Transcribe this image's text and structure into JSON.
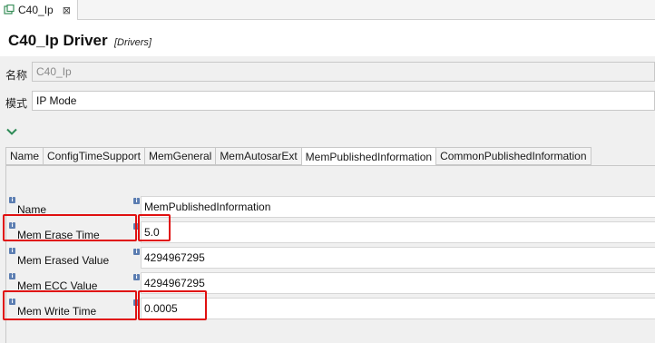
{
  "editor_tab": {
    "label": "C40_Ip",
    "close": "⊠"
  },
  "header": {
    "title": "C40_Ip Driver",
    "subtitle": "[Drivers]"
  },
  "name_row": {
    "label": "名称",
    "value": "C40_Ip"
  },
  "mode_row": {
    "label": "模式",
    "value": "IP Mode"
  },
  "tabs": [
    {
      "label": "Name"
    },
    {
      "label": "ConfigTimeSupport"
    },
    {
      "label": "MemGeneral"
    },
    {
      "label": "MemAutosarExt"
    },
    {
      "label": "MemPublishedInformation"
    },
    {
      "label": "CommonPublishedInformation"
    }
  ],
  "properties": [
    {
      "label": "Name",
      "value": "MemPublishedInformation"
    },
    {
      "label": "Mem Erase Time",
      "value": "5.0"
    },
    {
      "label": "Mem Erased Value",
      "value": "4294967295"
    },
    {
      "label": "Mem ECC Value",
      "value": "4294967295"
    },
    {
      "label": "Mem Write Time",
      "value": "0.0005"
    }
  ],
  "colors": {
    "highlight": "#e01010",
    "chevron": "#2e8b57",
    "info_icon": "#5b7db1"
  },
  "icons": {
    "tab_icon": "component-icon",
    "info": "info-icon",
    "expand": "chevron-down-icon"
  }
}
